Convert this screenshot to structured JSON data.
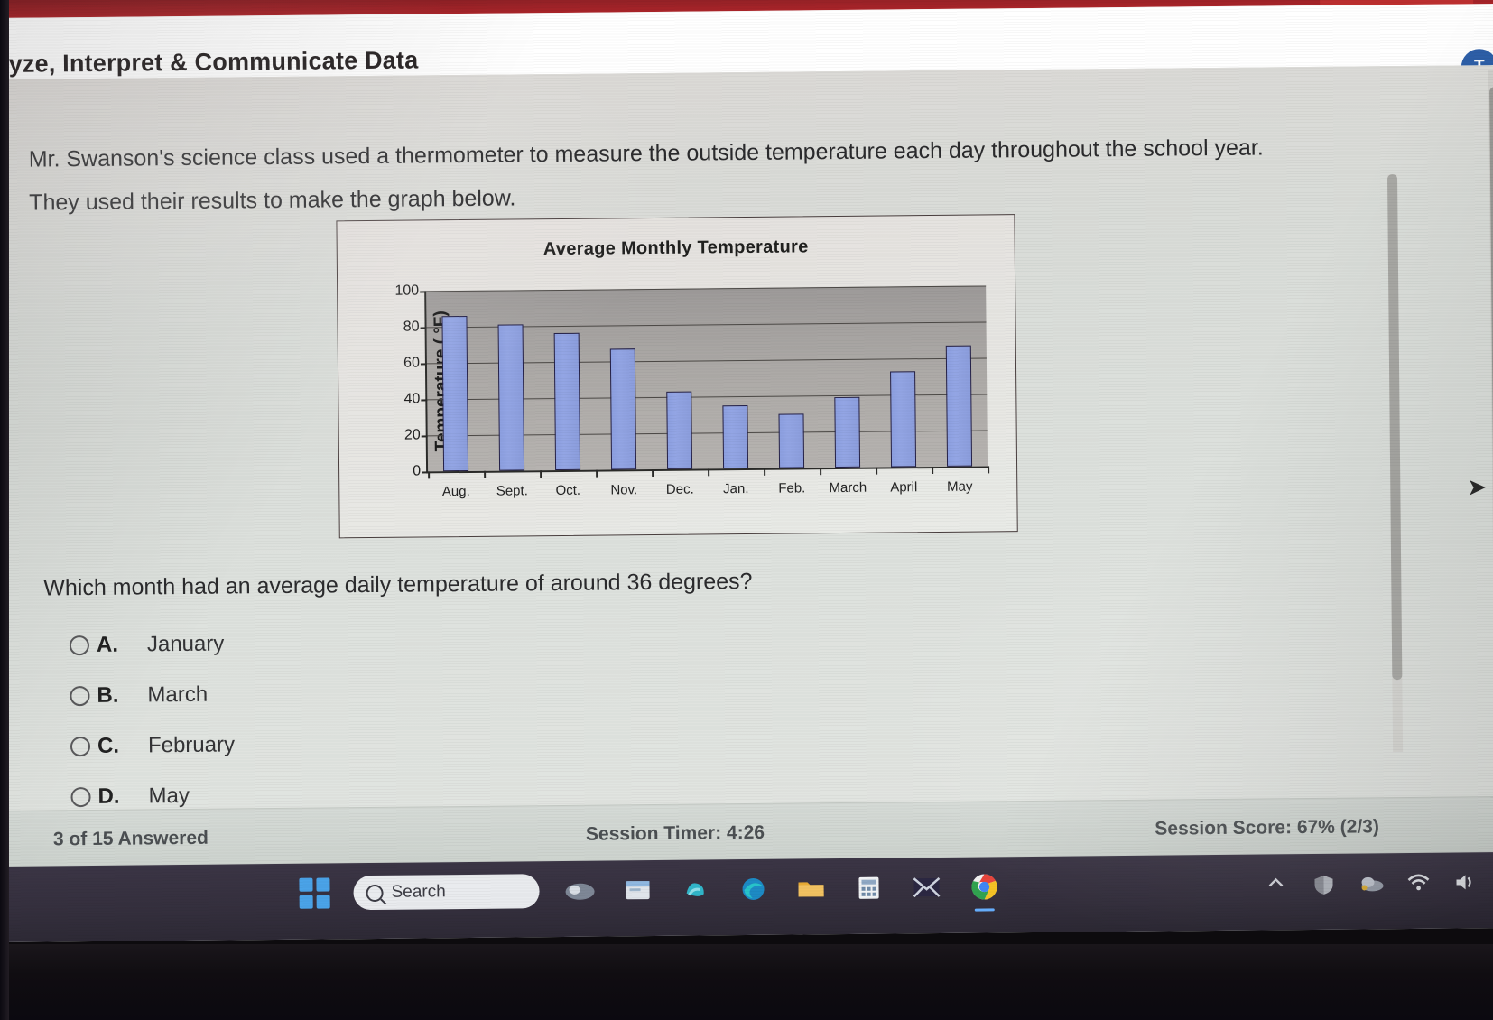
{
  "browser": {
    "tab_accent": "#b4262c"
  },
  "header": {
    "title": "alyze, Interpret & Communicate Data",
    "avatar_initial": "T"
  },
  "main": {
    "prompt_line1": "Mr. Swanson's science class used a thermometer to measure the outside temperature each day throughout the school year.",
    "prompt_line2": "They used their results to make the graph below.",
    "question": "Which month had an average daily temperature of around 36 degrees?",
    "options": [
      {
        "letter": "A.",
        "text": "January",
        "selected": false
      },
      {
        "letter": "B.",
        "text": "March",
        "selected": false
      },
      {
        "letter": "C.",
        "text": "February",
        "selected": false
      },
      {
        "letter": "D.",
        "text": "May",
        "selected": false
      }
    ]
  },
  "chart_data": {
    "type": "bar",
    "title": "Average Monthly Temperature",
    "xlabel": "",
    "ylabel": "Temperature ( °F)",
    "ylim": [
      0,
      100
    ],
    "yticks": [
      0,
      20,
      40,
      60,
      80,
      100
    ],
    "grid": true,
    "legend": "none",
    "bar_color": "#8fa1e2",
    "plot_bg": "#a9a6a3",
    "categories": [
      "Aug.",
      "Sept.",
      "Oct.",
      "Nov.",
      "Dec.",
      "Jan.",
      "Feb.",
      "March",
      "April",
      "May"
    ],
    "values": [
      86,
      81,
      76,
      67,
      43,
      35,
      30,
      39,
      53,
      67
    ]
  },
  "footer": {
    "answered": "3 of 15 Answered",
    "timer": "Session Timer: 4:26",
    "score": "Session Score: 67% (2/3)"
  },
  "taskbar": {
    "search_placeholder": "Search",
    "icons": [
      "start-icon",
      "search-icon",
      "widgets-icon",
      "file-explorer-icon",
      "copilot-icon",
      "edge-icon",
      "folder-icon",
      "calculator-icon",
      "mail-icon",
      "chrome-icon"
    ],
    "tray": [
      "chevron-up-icon",
      "defender-icon",
      "onedrive-icon",
      "wifi-icon",
      "volume-icon"
    ]
  }
}
